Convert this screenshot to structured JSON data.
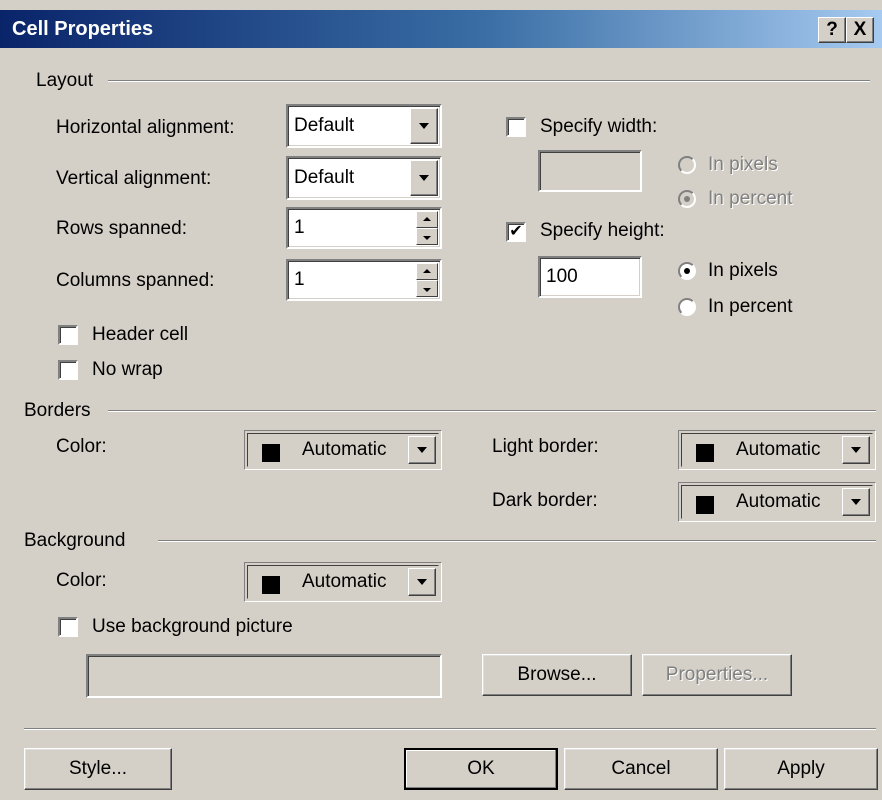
{
  "title": "Cell Properties",
  "titlebar": {
    "help": "?",
    "close": "X"
  },
  "layout": {
    "heading": "Layout",
    "h_align_label": "Horizontal alignment:",
    "h_align_value": "Default",
    "v_align_label": "Vertical alignment:",
    "v_align_value": "Default",
    "rows_label": "Rows spanned:",
    "rows_value": "1",
    "cols_label": "Columns spanned:",
    "cols_value": "1",
    "header_cell_label": "Header cell",
    "no_wrap_label": "No wrap",
    "specify_width_label": "Specify width:",
    "width_value": "",
    "width_in_pixels": "In pixels",
    "width_in_percent": "In percent",
    "specify_height_label": "Specify height:",
    "height_value": "100",
    "height_in_pixels": "In pixels",
    "height_in_percent": "In percent"
  },
  "borders": {
    "heading": "Borders",
    "color_label": "Color:",
    "color_value": "Automatic",
    "light_label": "Light border:",
    "light_value": "Automatic",
    "dark_label": "Dark border:",
    "dark_value": "Automatic"
  },
  "background": {
    "heading": "Background",
    "color_label": "Color:",
    "color_value": "Automatic",
    "use_picture_label": "Use background picture",
    "picture_path": "",
    "browse_label": "Browse...",
    "properties_label": "Properties..."
  },
  "footer": {
    "style_label": "Style...",
    "ok_label": "OK",
    "cancel_label": "Cancel",
    "apply_label": "Apply"
  },
  "colors": {
    "dialog_bg": "#d4d0c8",
    "title_start": "#0a246a",
    "title_end": "#a6caf0",
    "swatch": "#000000"
  }
}
